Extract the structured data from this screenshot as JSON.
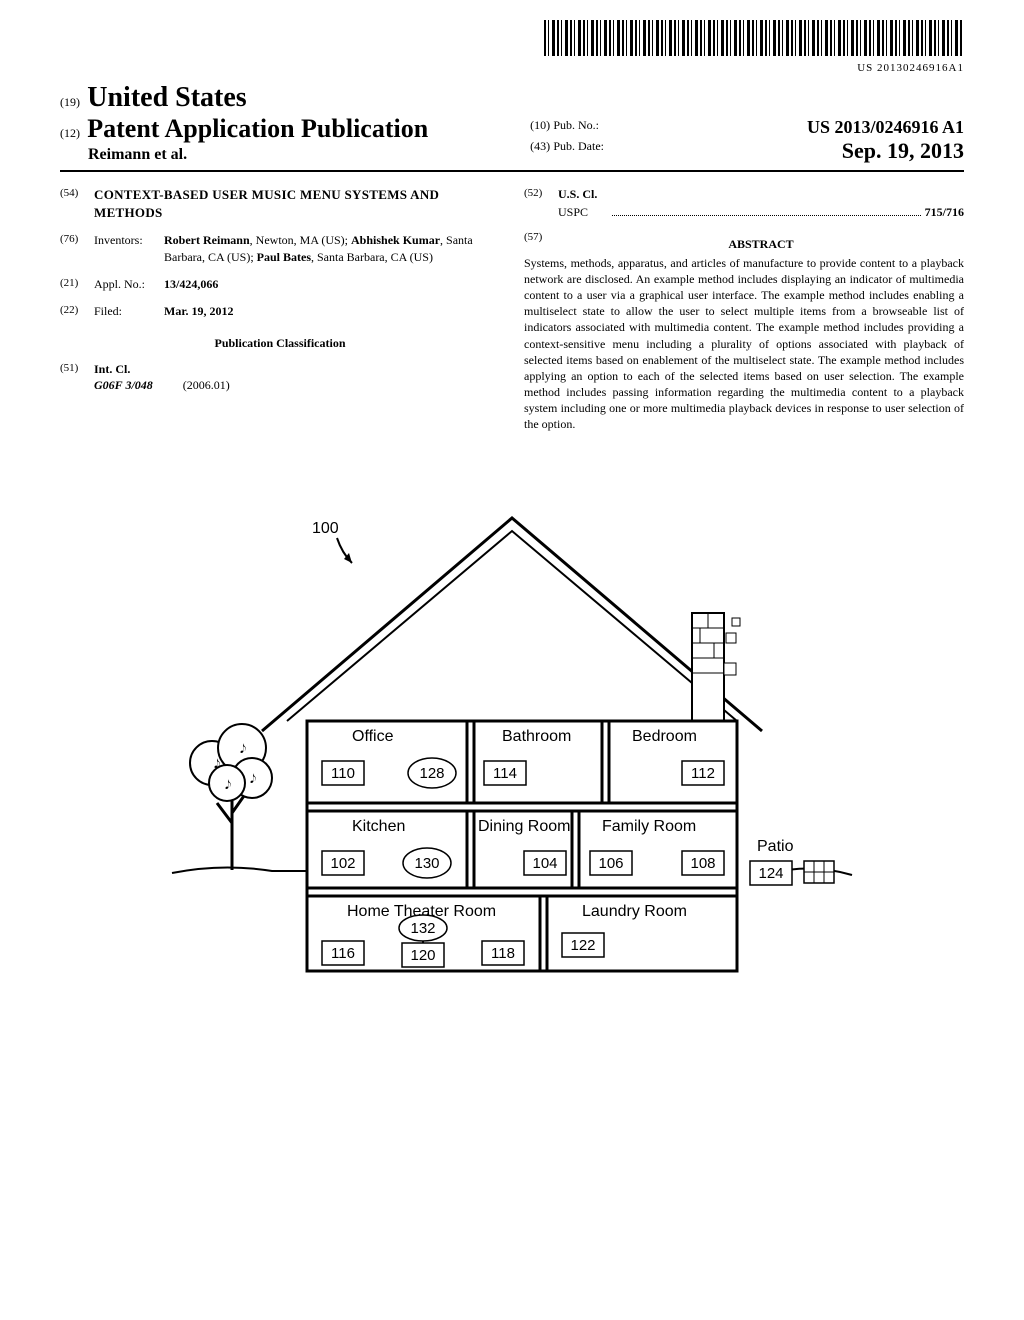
{
  "barcode_text": "US 20130246916A1",
  "header": {
    "code19": "(19)",
    "country": "United States",
    "code12": "(12)",
    "pub_type": "Patent Application Publication",
    "authors": "Reimann et al.",
    "code10": "(10)",
    "pub_no_label": "Pub. No.:",
    "pub_no": "US 2013/0246916 A1",
    "code43": "(43)",
    "pub_date_label": "Pub. Date:",
    "pub_date": "Sep. 19, 2013"
  },
  "fields": {
    "f54": {
      "code": "(54)",
      "value": "CONTEXT-BASED USER MUSIC MENU SYSTEMS AND METHODS"
    },
    "f76": {
      "code": "(76)",
      "label": "Inventors:",
      "value": "Robert Reimann, Newton, MA (US); Abhishek Kumar, Santa Barbara, CA (US); Paul Bates, Santa Barbara, CA (US)"
    },
    "f21": {
      "code": "(21)",
      "label": "Appl. No.:",
      "value": "13/424,066"
    },
    "f22": {
      "code": "(22)",
      "label": "Filed:",
      "value": "Mar. 19, 2012"
    },
    "pub_class": "Publication Classification",
    "f51": {
      "code": "(51)",
      "label": "Int. Cl.",
      "sub": "G06F 3/048",
      "year": "(2006.01)"
    },
    "f52": {
      "code": "(52)",
      "label": "U.S. Cl.",
      "uspc_label": "USPC",
      "uspc_val": "715/716"
    },
    "f57": {
      "code": "(57)",
      "heading": "ABSTRACT"
    }
  },
  "abstract": "Systems, methods, apparatus, and articles of manufacture to provide content to a playback network are disclosed. An example method includes displaying an indicator of multimedia content to a user via a graphical user interface. The example method includes enabling a multiselect state to allow the user to select multiple items from a browseable list of indicators associated with multimedia content. The example method includes providing a context-sensitive menu including a plurality of options associated with playback of selected items based on enablement of the multiselect state. The example method includes applying an option to each of the selected items based on user selection. The example method includes passing information regarding the multimedia content to a playback system including one or more multimedia playback devices in response to user selection of the option.",
  "figure": {
    "main_ref": "100",
    "rooms": {
      "office": {
        "label": "Office",
        "refs": [
          "110"
        ],
        "ellipse": "128"
      },
      "bathroom": {
        "label": "Bathroom",
        "refs": [
          "114"
        ]
      },
      "bedroom": {
        "label": "Bedroom",
        "refs": [
          "112"
        ]
      },
      "kitchen": {
        "label": "Kitchen",
        "refs": [
          "102"
        ],
        "ellipse": "130"
      },
      "dining": {
        "label": "Dining Room",
        "refs": [
          "104"
        ]
      },
      "family": {
        "label": "Family Room",
        "refs": [
          "106",
          "108"
        ]
      },
      "patio": {
        "label": "Patio",
        "refs": [
          "124"
        ]
      },
      "theater": {
        "label": "Home Theater Room",
        "refs": [
          "116",
          "118",
          "120"
        ],
        "ellipse": "132"
      },
      "laundry": {
        "label": "Laundry Room",
        "refs": [
          "122"
        ]
      }
    }
  }
}
